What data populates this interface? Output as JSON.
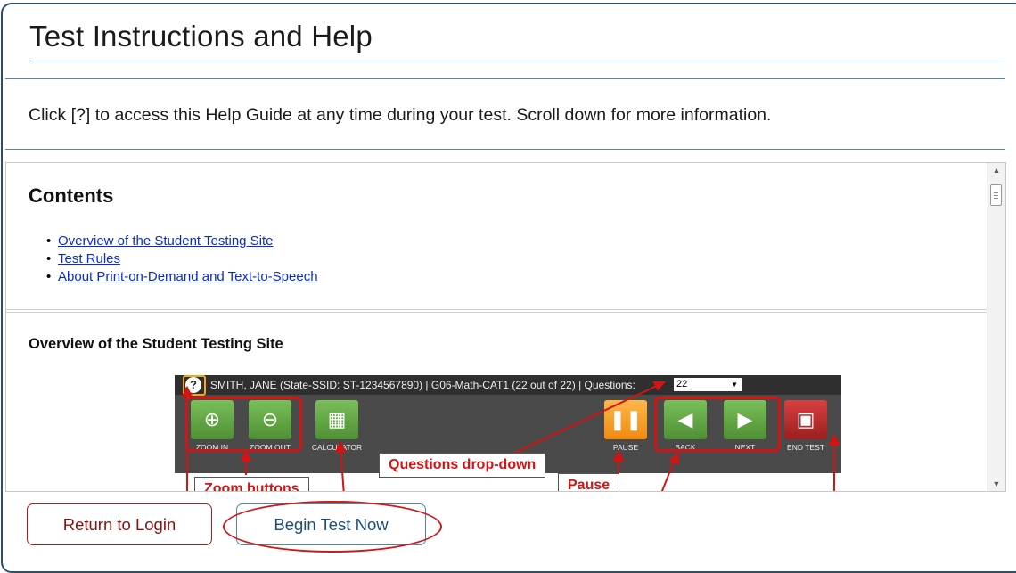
{
  "page": {
    "title": "Test Instructions and Help",
    "instructions": "Click [?] to access this Help Guide at any time during your test. Scroll down for more information."
  },
  "contents": {
    "heading": "Contents",
    "links": [
      "Overview of the Student Testing Site",
      "Test Rules",
      "About Print-on-Demand and Text-to-Speech"
    ]
  },
  "overview": {
    "heading": "Overview of the Student Testing Site",
    "screenshot": {
      "status_text": "SMITH, JANE (State-SSID: ST-1234567890)  |  G06-Math-CAT1 (22 out of 22)  |  Questions:",
      "question_value": "22",
      "buttons": {
        "zoom_in": "ZOOM IN",
        "zoom_out": "ZOOM OUT",
        "calculator": "CALCULATOR",
        "pause": "PAUSE",
        "back": "BACK",
        "next": "NEXT",
        "end_test": "END TEST"
      },
      "callouts": {
        "zoom": "Zoom buttons",
        "questions": "Questions drop-down",
        "pause": "Pause"
      }
    }
  },
  "footer": {
    "return_label": "Return to Login",
    "begin_label": "Begin Test Now"
  },
  "colors": {
    "accent_rule": "#4a87b3",
    "link": "#0a2bd6",
    "return_button": "#b01a1a",
    "highlight": "#d01818"
  }
}
